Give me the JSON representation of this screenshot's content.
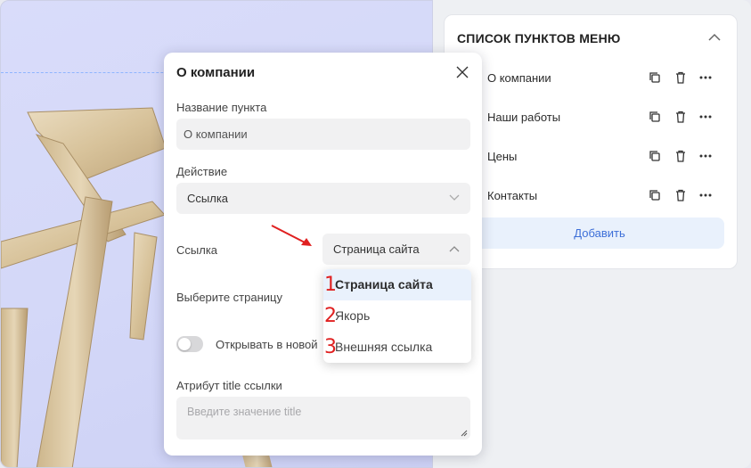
{
  "menu_panel": {
    "title": "СПИСОК ПУНКТОВ МЕНЮ",
    "items": [
      {
        "label": "О компании"
      },
      {
        "label": "Наши работы"
      },
      {
        "label": "Цены"
      },
      {
        "label": "Контакты"
      }
    ],
    "add_label": "Добавить"
  },
  "dialog": {
    "title": "О компании",
    "name_label": "Название пункта",
    "name_value": "О компании",
    "action_label": "Действие",
    "action_value": "Ссылка",
    "link_label": "Ссылка",
    "link_value": "Страница сайта",
    "page_label": "Выберите страницу",
    "new_tab_label": "Открывать в новой",
    "title_attr_label": "Атрибут title ссылки",
    "title_attr_placeholder": "Введите значение title"
  },
  "dropdown": {
    "options": [
      {
        "num": "1",
        "label": "Страница сайта",
        "selected": true
      },
      {
        "num": "2",
        "label": "Якорь"
      },
      {
        "num": "3",
        "label": "Внешняя ссылка"
      }
    ]
  },
  "colors": {
    "accent": "#3d6fd8",
    "annotation": "#e02020",
    "canvas_bg": "#d6d9f8"
  }
}
